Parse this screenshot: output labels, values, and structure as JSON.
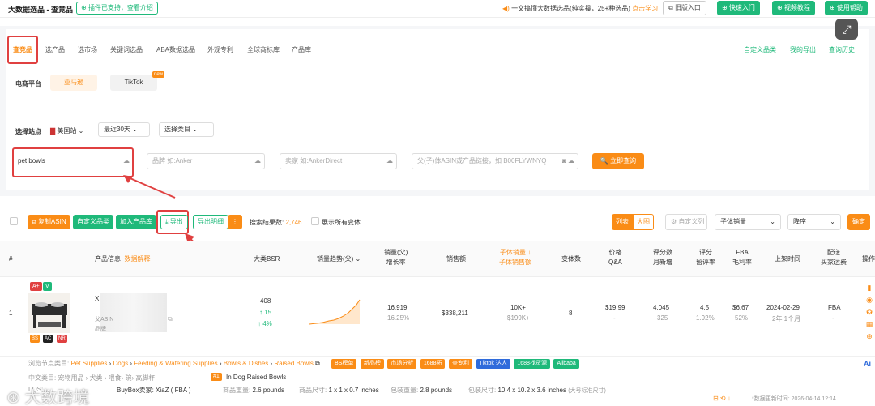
{
  "topbar": {
    "title": "大数据选品 - 查竞品",
    "plugin_note": "插件已支持，查看介绍",
    "announce": "一文搞懂大数据选品(纯实操，25+种选品)",
    "announce_link": "点击学习",
    "old_entry": "旧版入口",
    "quick_start": "快速入门",
    "video_tutorial": "视频教程",
    "help": "使用帮助"
  },
  "nav": {
    "tabs": [
      "查竞品",
      "选产品",
      "选市场",
      "关键词选品",
      "ABA数据选品",
      "外观专利",
      "全球商标库",
      "产品库"
    ],
    "right_links": [
      "自定义品类",
      "我的导出",
      "查询历史"
    ]
  },
  "platform": {
    "label": "电商平台",
    "amazon": "亚马逊",
    "tiktok": "TikTok",
    "tiktok_badge": "new"
  },
  "site": {
    "label": "选择站点",
    "country": "美国站",
    "period": "最近30天",
    "category": "选择类目"
  },
  "search": {
    "keyword": "pet bowls",
    "brand_placeholder": "品牌 如:Anker",
    "seller_placeholder": "卖家 如:AnkerDirect",
    "asin_placeholder": "父(子)体ASIN或产品链接，如 B00FLYWNYQ",
    "query_btn": "立即查询"
  },
  "toolbar": {
    "copy_asin": "复制ASIN",
    "custom_cat": "自定义品类",
    "add_lib": "加入产品库",
    "export": "导出",
    "export_detail": "导出明细",
    "more": "⋮",
    "result_label": "搜索结果数:",
    "result_count": "2,746",
    "show_variants": "展示所有变体",
    "view_list": "列表",
    "view_grid": "大图",
    "custom_cols": "自定义列",
    "sort_field": "子体销量",
    "sort_order": "降序",
    "confirm": "确定"
  },
  "table": {
    "headers": {
      "idx": "#",
      "product": "产品信息",
      "product_link": "数据解释",
      "bsr": "大类BSR",
      "trend": "销量趋势(父)",
      "sales_a": "销量(父)",
      "sales_b": "增长率",
      "revenue": "销售额",
      "child_a": "子体销量",
      "child_b": "子体销售额",
      "variants": "变体数",
      "price_a": "价格",
      "price_b": "Q&A",
      "reviews_a": "评分数",
      "reviews_b": "月新增",
      "rating_a": "评分",
      "rating_b": "留评率",
      "fba_a": "FBA",
      "fba_b": "毛利率",
      "launch": "上架时间",
      "ship_a": "配送",
      "ship_b": "买家运费",
      "ops": "操作"
    },
    "row": {
      "idx": "1",
      "badge_a": "A+",
      "badge_v": "V",
      "mini_tags": [
        "BS",
        "AC",
        "NR"
      ],
      "title_start": "X",
      "asin_line": "父ASIN",
      "brand_prefix": "品牌",
      "bsr": "408",
      "bsr_change": "↑ 15",
      "bsr_pct": "↑ 4%",
      "sales": "16,919",
      "growth": "16.25%",
      "revenue": "$338,211",
      "child_sales": "10K+",
      "child_revenue": "$199K+",
      "variants": "8",
      "price": "$19.99",
      "qa": "-",
      "reviews": "4,045",
      "reviews_new": "325",
      "rating": "4.5",
      "review_rate": "1.92%",
      "fba": "$6.67",
      "margin": "52%",
      "launch": "2024-02-29",
      "launch_age": "2年 1个月",
      "ship": "FBA",
      "ship_fee": "-"
    },
    "crumb_label": "浏览节点类目:",
    "crumbs": [
      "Pet Supplies",
      "Dogs",
      "Feeding & Watering Supplies",
      "Bowls & Dishes",
      "Raised Bowls"
    ],
    "crumb_tags": [
      "BS榜单",
      "新品榜",
      "市场分析",
      "1688拓",
      "查专利",
      "Tiktok 达人",
      "1688找货源",
      "Alibaba"
    ],
    "cn_crumb": "中文类目: 宠物用品 › 犬类 › 喂食› 碗› 高脚杯",
    "rank_badge": "#1",
    "rank_text": "In  Dog Raised Bowls",
    "lqs": "LQS:",
    "buybox": "BuyBox卖家: XiaZ ( FBA )",
    "weight_label": "商品重量:",
    "weight": "2.6 pounds",
    "size_label": "商品尺寸:",
    "size": "1 x 1 x 0.7 inches",
    "pkg_weight_label": "包装重量:",
    "pkg_weight": "2.8 pounds",
    "pkg_size_label": "包装尺寸:",
    "pkg_size": "10.4 x 10.2 x 3.6 inches",
    "size_tier": "(大号标准尺寸)",
    "update_note": "*数据更新时间: 2026-04-14 12:14"
  },
  "watermark": "大数跨境",
  "colors": {
    "green": "#1fb97a",
    "orange": "#fa8c16",
    "red": "#e04040"
  }
}
